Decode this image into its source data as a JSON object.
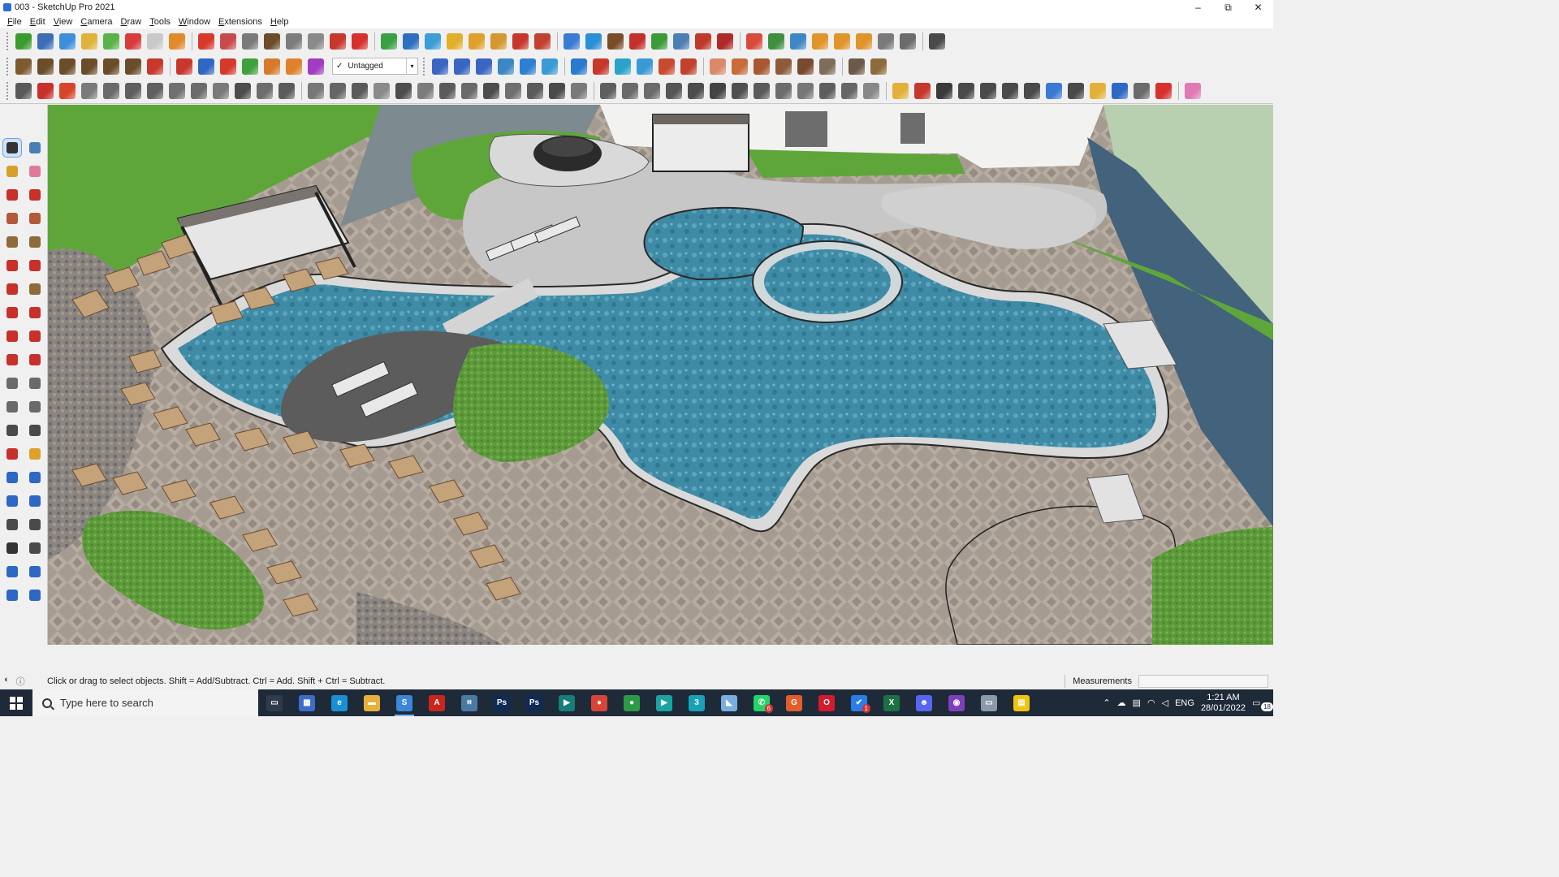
{
  "window": {
    "title": "003 - SketchUp Pro 2021",
    "minimize": "–",
    "maximize": "⧉",
    "close": "✕"
  },
  "menu": [
    "File",
    "Edit",
    "View",
    "Camera",
    "Draw",
    "Tools",
    "Window",
    "Extensions",
    "Help"
  ],
  "tag_dropdown": {
    "check": "✓",
    "value": "Untagged",
    "arrow": "▾"
  },
  "statusbar": {
    "hint": "Click or drag to select objects. Shift = Add/Subtract. Ctrl = Add. Shift + Ctrl = Subtract.",
    "measurements_label": "Measurements"
  },
  "taskbar": {
    "search_placeholder": "Type here to search",
    "apps": [
      {
        "name": "task-view",
        "glyph": "▭",
        "color": "#2f3b4b"
      },
      {
        "name": "calculator",
        "glyph": "▦",
        "color": "#3a6ec9"
      },
      {
        "name": "edge",
        "glyph": "e",
        "color": "#1a8fd6"
      },
      {
        "name": "file-explorer",
        "glyph": "▬",
        "color": "#e8b13c"
      },
      {
        "name": "sketchup",
        "glyph": "S",
        "color": "#3c85d8",
        "active": true
      },
      {
        "name": "acrobat",
        "glyph": "A",
        "color": "#c8261d"
      },
      {
        "name": "app-a",
        "glyph": "⌗",
        "color": "#4a7aa3"
      },
      {
        "name": "photoshop-1",
        "glyph": "Ps",
        "color": "#0f2a55"
      },
      {
        "name": "photoshop-2",
        "glyph": "Ps",
        "color": "#0f2a55"
      },
      {
        "name": "app-layout",
        "glyph": "▶",
        "color": "#167d7a"
      },
      {
        "name": "chrome-1",
        "glyph": "●",
        "color": "#d9443a"
      },
      {
        "name": "chrome-2",
        "glyph": "●",
        "color": "#2c9b48"
      },
      {
        "name": "app-b",
        "glyph": "▶",
        "color": "#1aa3a3"
      },
      {
        "name": "app-3d",
        "glyph": "3",
        "color": "#17a2b8"
      },
      {
        "name": "app-c",
        "glyph": "◣",
        "color": "#7aaede"
      },
      {
        "name": "whatsapp",
        "glyph": "✆",
        "color": "#25d366",
        "badge": "6"
      },
      {
        "name": "grammarly",
        "glyph": "G",
        "color": "#e35d2c"
      },
      {
        "name": "opera",
        "glyph": "O",
        "color": "#d21b2c"
      },
      {
        "name": "app-d",
        "glyph": "✔",
        "color": "#2b7de9",
        "badge": "1"
      },
      {
        "name": "excel",
        "glyph": "X",
        "color": "#1d7044"
      },
      {
        "name": "discord",
        "glyph": "☻",
        "color": "#5865f2"
      },
      {
        "name": "app-e",
        "glyph": "◉",
        "color": "#7e3fbf"
      },
      {
        "name": "app-f",
        "glyph": "▭",
        "color": "#8b9aab"
      },
      {
        "name": "sticky-notes",
        "glyph": "▤",
        "color": "#f1c40f"
      }
    ],
    "tray": {
      "chevron": "⌃",
      "lang": "ENG",
      "time": "1:21 AM",
      "date": "28/01/2022",
      "notifications": "18"
    }
  },
  "toolbar_colors": {
    "row1": [
      "#3a9b2e",
      "#3e6db8",
      "#3d8fdc",
      "#e0b23a",
      "#5ab34a",
      "#d83c3c",
      "#c9c9c9",
      "#e08a2a",
      "#d73a2c",
      "#c84b4b",
      "#7a7a7a",
      "#6b4d2a",
      "#7d7d7d",
      "#8a8a8a",
      "#c8372c",
      "#d8302e",
      "#39a044",
      "#2e6fc2",
      "#3d9dd6",
      "#e1b02a",
      "#e0a02c",
      "#d59830",
      "#c9372c",
      "#c2402e",
      "#3a7bd5",
      "#2b8fd6",
      "#7a4d2a",
      "#c4302a",
      "#3a9b3a",
      "#4d7db5",
      "#c0392b",
      "#b02a2a",
      "#d84b3a",
      "#3f8f3f",
      "#3e87c5",
      "#e0942a",
      "#e0942a",
      "#e0942a",
      "#7a7a7a",
      "#6c6c6c",
      "#4a4a4a"
    ],
    "row2a": [
      "#7d5a2f",
      "#6b4d2a",
      "#6b4d2a",
      "#6b4d2a",
      "#6b4d2a",
      "#6b4d2a",
      "#c8372c",
      "#c8372c",
      "#2e67c4",
      "#d53a2a",
      "#3fa13c",
      "#d77b2a",
      "#e0822a",
      "#a23cc2"
    ],
    "row2b": [
      "#3a66c2",
      "#3a66c2",
      "#3a66c2",
      "#3e87c5",
      "#2e7fd1",
      "#3a9bd5",
      "#2a7ad1",
      "#c8372c",
      "#2aa3c9",
      "#3a9ad8",
      "#c84b2e",
      "#c2402e",
      "#d98a6a",
      "#c96b3a",
      "#a8572e",
      "#8d5a3a",
      "#7a4a2e",
      "#7d6d5a",
      "#6b5a4a",
      "#8d6b3a"
    ],
    "row3": [
      "#5a5a5a",
      "#c8302a",
      "#d8452a",
      "#7a7a7a",
      "#6a6a6a",
      "#5f5f5f",
      "#606060",
      "#707070",
      "#6c6c6c",
      "#7a7a7a",
      "#4d4d4d",
      "#6d6d6d",
      "#5b5b5b",
      "#777777",
      "#666666",
      "#5a5a5a",
      "#8a8a8a",
      "#4e4e4e",
      "#7c7c7c",
      "#5b5b5b",
      "#6a6a6a",
      "#4d4d4d",
      "#6f6f6f",
      "#5b5b5b",
      "#4a4a4a",
      "#7a7a7a",
      "#5f5f5f",
      "#6a6a6a",
      "#6b6b6b",
      "#565656",
      "#4c4c4c",
      "#444444",
      "#505050",
      "#5a5a5a",
      "#6d6d6d",
      "#777777",
      "#5e5e5e",
      "#666666",
      "#888888",
      "#e2b13a",
      "#c8372c",
      "#3a3a3a",
      "#4a4a4a",
      "#4a4a4a",
      "#4a4a4a",
      "#4a4a4a",
      "#3a7ad5",
      "#4a4a4a",
      "#e2b13a",
      "#2e67c4",
      "#6b6b6b",
      "#d8302e",
      "#e07ab5"
    ]
  },
  "tools": [
    {
      "name": "select-tool",
      "color": "#333333",
      "selected": true
    },
    {
      "name": "component-tool",
      "color": "#4a7fb5"
    },
    {
      "name": "paint-bucket-tool",
      "color": "#d8a02a"
    },
    {
      "name": "eraser-tool",
      "color": "#e07a9b"
    },
    {
      "name": "line-tool",
      "color": "#c8302a"
    },
    {
      "name": "freehand-tool",
      "color": "#c8302a"
    },
    {
      "name": "rectangle-tool",
      "color": "#b05a3a"
    },
    {
      "name": "rotated-rectangle-tool",
      "color": "#b05a3a"
    },
    {
      "name": "circle-tool",
      "color": "#8d6b3a"
    },
    {
      "name": "polygon-tool",
      "color": "#8d6b3a"
    },
    {
      "name": "arc-tool",
      "color": "#c8302a"
    },
    {
      "name": "two-point-arc-tool",
      "color": "#c8302a"
    },
    {
      "name": "three-point-arc-tool",
      "color": "#c8302a"
    },
    {
      "name": "pie-tool",
      "color": "#8d6b3a"
    },
    {
      "name": "move-tool",
      "color": "#c8302a"
    },
    {
      "name": "push-pull-tool",
      "color": "#c8302a"
    },
    {
      "name": "rotate-tool",
      "color": "#c8302a"
    },
    {
      "name": "follow-me-tool",
      "color": "#c8302a"
    },
    {
      "name": "scale-tool",
      "color": "#c8302a"
    },
    {
      "name": "offset-tool",
      "color": "#c8302a"
    },
    {
      "name": "tape-measure-tool",
      "color": "#6a6a6a"
    },
    {
      "name": "dimension-tool",
      "color": "#6a6a6a"
    },
    {
      "name": "protractor-tool",
      "color": "#6a6a6a"
    },
    {
      "name": "text-tool",
      "color": "#6a6a6a"
    },
    {
      "name": "axes-tool",
      "color": "#4a4a4a"
    },
    {
      "name": "3d-text-tool",
      "color": "#4a4a4a"
    },
    {
      "name": "orbit-tool",
      "color": "#c8302a"
    },
    {
      "name": "pan-tool",
      "color": "#e0a02c"
    },
    {
      "name": "zoom-tool",
      "color": "#2e67c4"
    },
    {
      "name": "zoom-window-tool",
      "color": "#2e67c4"
    },
    {
      "name": "zoom-extents-tool",
      "color": "#2e67c4"
    },
    {
      "name": "previous-view-tool",
      "color": "#2e67c4"
    },
    {
      "name": "position-camera-tool",
      "color": "#4a4a4a"
    },
    {
      "name": "look-around-tool",
      "color": "#4a4a4a"
    },
    {
      "name": "walk-tool",
      "color": "#333333"
    },
    {
      "name": "section-plane-tool",
      "color": "#4a4a4a"
    },
    {
      "name": "sandbox-from-contours-tool",
      "color": "#2e67c4"
    },
    {
      "name": "sandbox-from-scratch-tool",
      "color": "#2e67c4"
    },
    {
      "name": "smoove-tool",
      "color": "#2e67c4"
    },
    {
      "name": "stamp-tool",
      "color": "#2e67c4"
    }
  ]
}
